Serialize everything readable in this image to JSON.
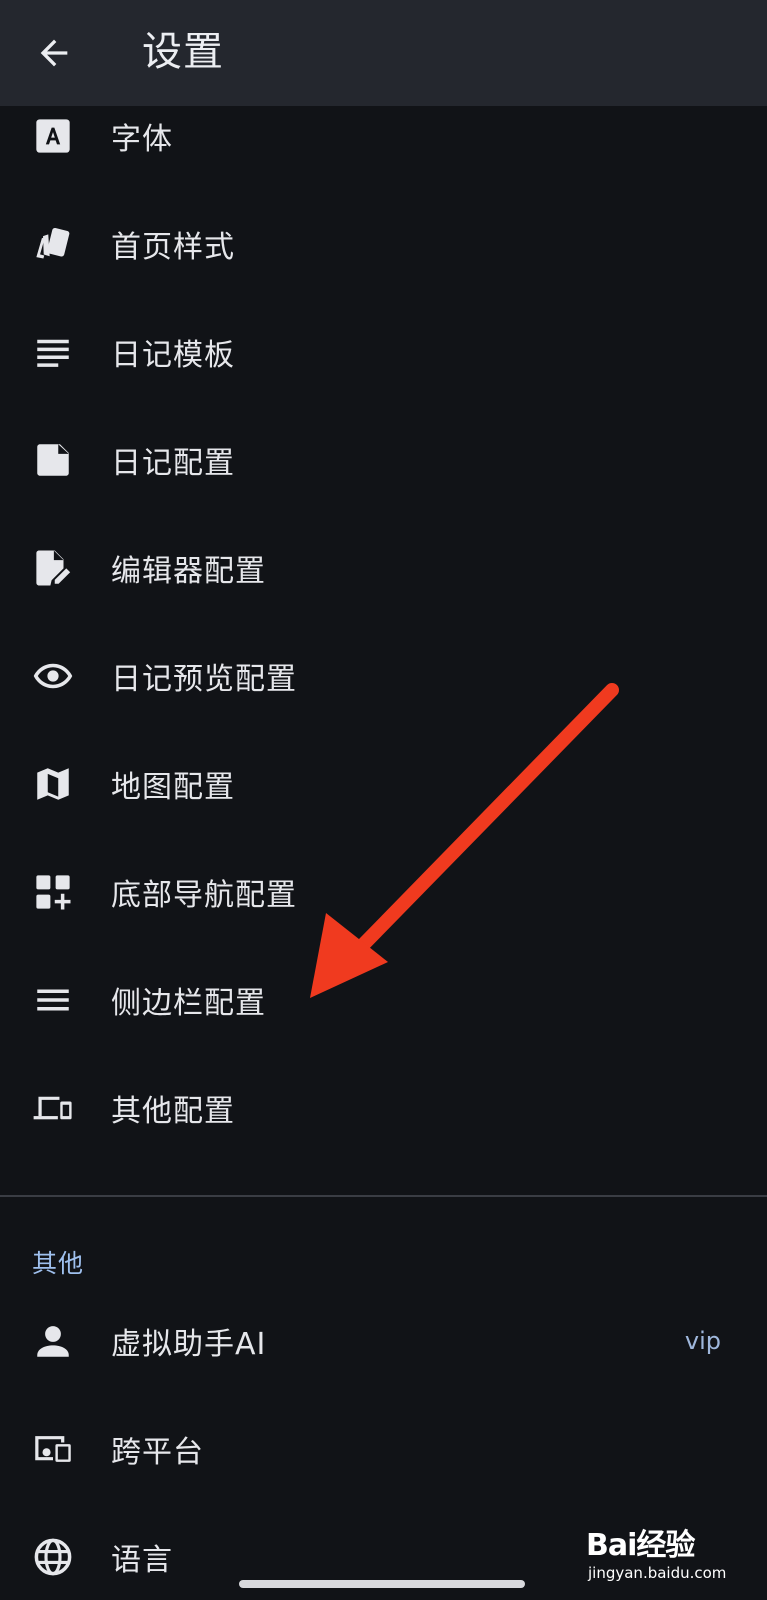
{
  "header": {
    "title": "设置",
    "back_icon": "arrow-left-icon"
  },
  "items": [
    {
      "label": "字体",
      "icon": "font-icon"
    },
    {
      "label": "首页样式",
      "icon": "cards-style-icon"
    },
    {
      "label": "日记模板",
      "icon": "text-lines-icon"
    },
    {
      "label": "日记配置",
      "icon": "note-icon"
    },
    {
      "label": "编辑器配置",
      "icon": "edit-document-icon"
    },
    {
      "label": "日记预览配置",
      "icon": "eye-icon"
    },
    {
      "label": "地图配置",
      "icon": "map-icon"
    },
    {
      "label": "底部导航配置",
      "icon": "dashboard-add-icon"
    },
    {
      "label": "侧边栏配置",
      "icon": "menu-icon"
    },
    {
      "label": "其他配置",
      "icon": "devices-icon"
    }
  ],
  "other_section": {
    "header": "其他",
    "items": [
      {
        "label": "虚拟助手AI",
        "icon": "person-icon",
        "trail": "vip"
      },
      {
        "label": "跨平台",
        "icon": "cross-platform-icon"
      },
      {
        "label": "语言",
        "icon": "globe-icon"
      }
    ]
  },
  "watermark": {
    "logo": "Bai经验",
    "sub": "jingyan.baidu.com"
  },
  "colors": {
    "background": "#111317",
    "app_bar": "#24272e",
    "accent": "#9fc0ee",
    "arrow": "#f03a1f"
  }
}
